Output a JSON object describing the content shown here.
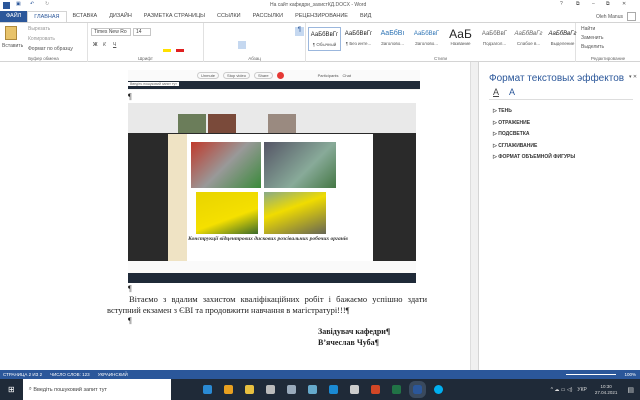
{
  "window": {
    "title": "На сайт кафедри_захистКД.DOCX - Word",
    "user": "Oleh Manus",
    "help": "?",
    "minimize": "–",
    "restore": "⧉",
    "close": "✕"
  },
  "tabs": [
    "ФАЙЛ",
    "ГЛАВНАЯ",
    "ВСТАВКА",
    "ДИЗАЙН",
    "РАЗМЕТКА СТРАНИЦЫ",
    "ССЫЛКИ",
    "РАССЫЛКИ",
    "РЕЦЕНЗИРОВАНИЕ",
    "ВИД"
  ],
  "ribbon": {
    "clipboard": {
      "paste": "Вставить",
      "cut": "Вырезать",
      "copy": "Копировать",
      "format_painter": "Формат по образцу",
      "label": "Буфер обмена"
    },
    "font": {
      "name": "Times New Ro",
      "size": "14",
      "label": "Шрифт",
      "bold": "Ж",
      "italic": "К",
      "underline": "Ч"
    },
    "paragraph": {
      "label": "Абзац"
    },
    "styles": {
      "label": "Стили",
      "items": [
        {
          "preview": "АаБбВвГг",
          "name": "¶ Обычный"
        },
        {
          "preview": "АаБбВвГг",
          "name": "¶ Без инте..."
        },
        {
          "preview": "АаБбВı",
          "name": "Заголово..."
        },
        {
          "preview": "АаБбВвГ",
          "name": "Заголово..."
        },
        {
          "preview": "АаБ",
          "name": "Название"
        },
        {
          "preview": "АаБбВвГ",
          "name": "Подзагол..."
        },
        {
          "preview": "АаБбВвГг",
          "name": "Слабое в..."
        },
        {
          "preview": "АаБбВвГг",
          "name": "Выделение"
        }
      ]
    },
    "editing": {
      "find": "Найти",
      "replace": "Заменить",
      "select": "Выделить",
      "label": "Редактирование"
    }
  },
  "document": {
    "pilcrow": "¶",
    "body": "Вітаємо з вдалим захистом кваліфікаційних робіт і бажаємо успішно здати вступний екзамен з ЄВІ та продовжити навчання в магістратурі!!!¶",
    "signature_title": "Завідувач кафедри¶",
    "signature_name": "В’ячеслав Чуба¶",
    "image_caption": "Конструкції відцентрових дискових розсівальних робочих органів",
    "webex_controls": [
      "Unmute",
      "Stop video",
      "Share",
      "Participants",
      "Chat"
    ],
    "embedded_search": "Введіть пошуковий запит тут"
  },
  "pane": {
    "title": "Формат текстовых эффектов",
    "sections": [
      "ТЕНЬ",
      "ОТРАЖЕНИЕ",
      "ПОДСВЕТКА",
      "СГЛАЖИВАНИЕ",
      "ФОРМАТ ОБЪЕМНОЙ ФИГУРЫ"
    ]
  },
  "status": {
    "page": "СТРАНИЦА 2 ИЗ 2",
    "words": "ЧИСЛО СЛОВ: 123",
    "language": "УКРАИНСКИЙ",
    "zoom": "100%"
  },
  "taskbar": {
    "search": "Введіть пошуковий запит тут",
    "lang": "УКР",
    "time": "10:30",
    "date": "27.04.2021"
  },
  "colors": {
    "accent": "#2b579a",
    "taskbar": "#1f2a38"
  }
}
